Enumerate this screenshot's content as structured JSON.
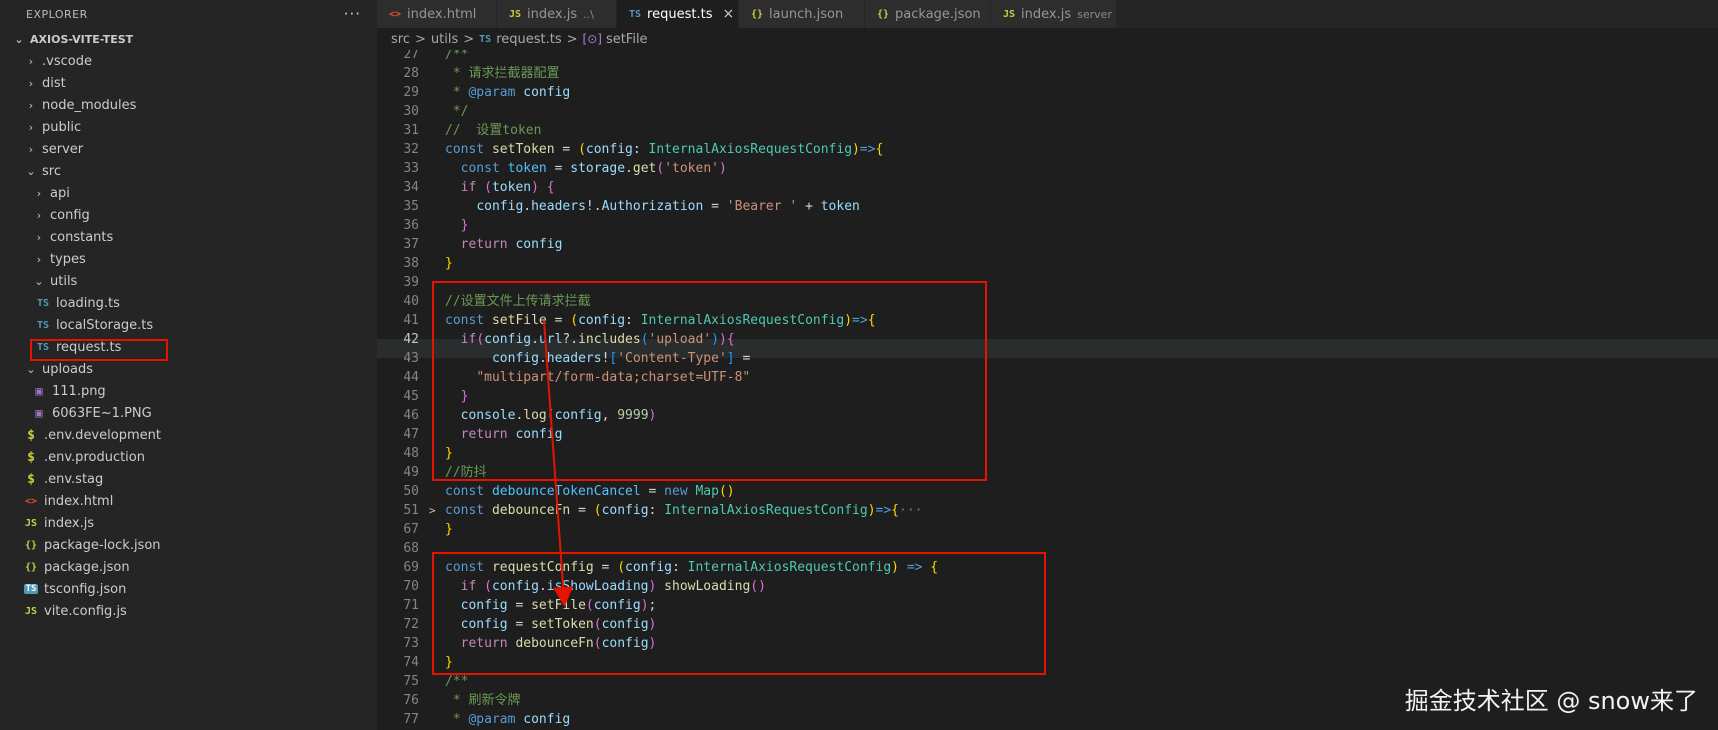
{
  "sidebar": {
    "title": "EXPLORER",
    "more": "···",
    "project": "AXIOS-VITE-TEST",
    "items": [
      {
        "label": ".vscode",
        "icon": "chevron-right"
      },
      {
        "label": "dist",
        "icon": "chevron-right"
      },
      {
        "label": "node_modules",
        "icon": "chevron-right"
      },
      {
        "label": "public",
        "icon": "chevron-right"
      },
      {
        "label": "server",
        "icon": "chevron-right"
      },
      {
        "label": "src",
        "icon": "chevron-down"
      },
      {
        "label": "api",
        "icon": "chevron-right"
      },
      {
        "label": "config",
        "icon": "chevron-right"
      },
      {
        "label": "constants",
        "icon": "chevron-right"
      },
      {
        "label": "types",
        "icon": "chevron-right"
      },
      {
        "label": "utils",
        "icon": "chevron-down"
      },
      {
        "label": "loading.ts",
        "icon": "TS"
      },
      {
        "label": "localStorage.ts",
        "icon": "TS"
      },
      {
        "label": "request.ts",
        "icon": "TS"
      },
      {
        "label": "uploads",
        "icon": "chevron-down"
      },
      {
        "label": "111.png",
        "icon": "image-icon"
      },
      {
        "label": "6063FE~1.PNG",
        "icon": "image-icon"
      },
      {
        "label": ".env.development",
        "icon": "$"
      },
      {
        "label": ".env.production",
        "icon": "$"
      },
      {
        "label": ".env.stag",
        "icon": "$"
      },
      {
        "label": "index.html",
        "icon": "<>"
      },
      {
        "label": "index.js",
        "icon": "JS"
      },
      {
        "label": "package-lock.json",
        "icon": "{}"
      },
      {
        "label": "package.json",
        "icon": "{}"
      },
      {
        "label": "tsconfig.json",
        "icon": "TS"
      },
      {
        "label": "vite.config.js",
        "icon": "JS"
      }
    ]
  },
  "tabs": [
    {
      "label": "index.html",
      "icon": "<>"
    },
    {
      "label": "index.js",
      "icon": "JS",
      "sub": "..\\"
    },
    {
      "label": "request.ts",
      "icon": "TS",
      "close": "×"
    },
    {
      "label": "launch.json",
      "icon": "{}"
    },
    {
      "label": "package.json",
      "icon": "{}"
    },
    {
      "label": "index.js",
      "icon": "JS",
      "sub": "server"
    }
  ],
  "breadcrumb": {
    "parts": [
      "src",
      "utils",
      "request.ts",
      "setFile"
    ],
    "sep": ">",
    "ts_icon": "TS",
    "fn_icon": "[⊙]"
  },
  "editor": {
    "line_numbers": [
      "27",
      "28",
      "29",
      "30",
      "31",
      "32",
      "33",
      "34",
      "35",
      "36",
      "37",
      "38",
      "39",
      "40",
      "41",
      "42",
      "43",
      "44",
      "45",
      "46",
      "47",
      "48",
      "49",
      "50",
      "51",
      "67",
      "68",
      "69",
      "70",
      "71",
      "72",
      "73",
      "74",
      "75",
      "76",
      "77"
    ],
    "fold_marker": ">",
    "collapsed_marker": "···"
  },
  "watermark": "掘金技术社区 @ snow来了",
  "colors": {
    "accent_red": "#e51400",
    "background": "#1e1e1e",
    "sidebar": "#252526"
  }
}
